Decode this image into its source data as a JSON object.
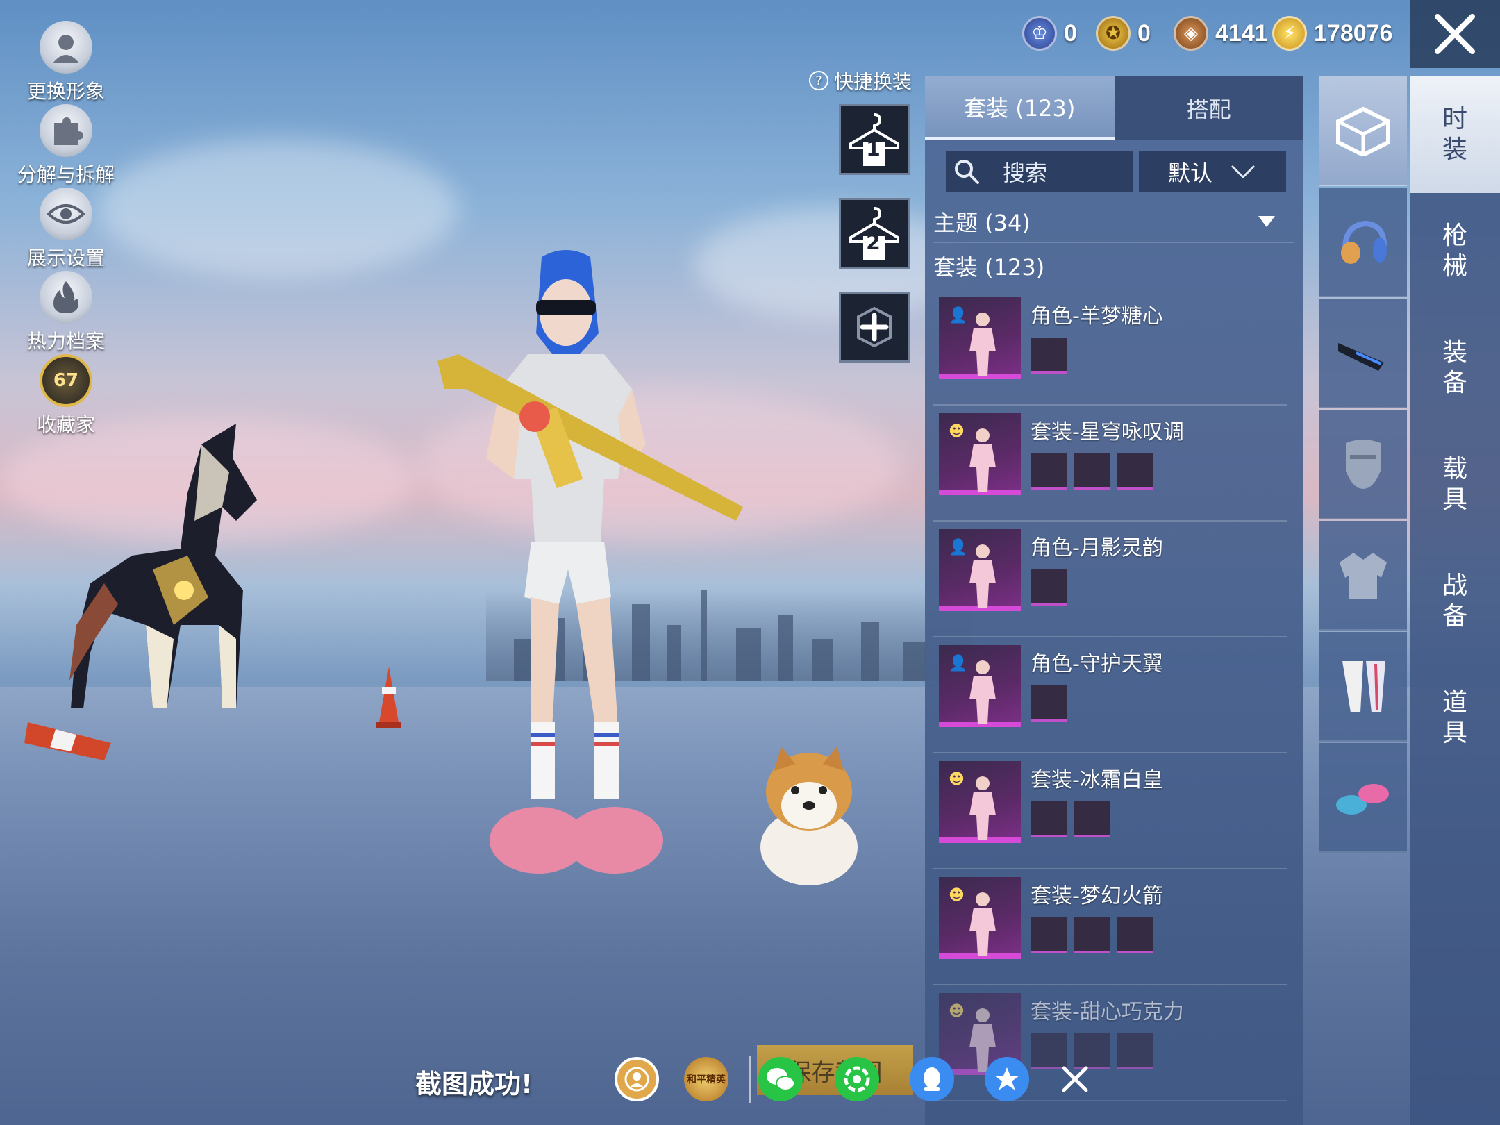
{
  "left_menu": [
    {
      "label": "更换形象",
      "icon": "avatar-icon"
    },
    {
      "label": "分解与拆解",
      "icon": "puzzle-icon"
    },
    {
      "label": "展示设置",
      "icon": "eye-icon"
    },
    {
      "label": "热力档案",
      "icon": "flame-icon"
    },
    {
      "label": "收藏家",
      "icon": "collector-badge-icon",
      "level": "67"
    }
  ],
  "currency": [
    {
      "icon": "token-blue-icon",
      "value": "0",
      "color": "#3a5fae"
    },
    {
      "icon": "token-gold-icon",
      "value": "0",
      "color": "#c89420"
    },
    {
      "icon": "coin-bronze-icon",
      "value": "4141",
      "color": "#a86a2c"
    },
    {
      "icon": "lightning-coin-icon",
      "value": "178076",
      "color": "#e8b820"
    }
  ],
  "quick_change": {
    "title": "快捷换装",
    "slots": [
      "1",
      "2"
    ]
  },
  "tabs": [
    {
      "label": "套装 (123)",
      "active": true
    },
    {
      "label": "搭配",
      "active": false
    }
  ],
  "search": {
    "placeholder": "搜索",
    "sort": "默认"
  },
  "sections": {
    "theme": "主题 (34)",
    "suits": "套装 (123)"
  },
  "items": [
    {
      "name": "角色-羊梦糖心",
      "badge": "role",
      "subs": 1
    },
    {
      "name": "套装-星穹咏叹调",
      "badge": "suit",
      "subs": 3
    },
    {
      "name": "角色-月影灵韵",
      "badge": "role",
      "subs": 1
    },
    {
      "name": "角色-守护天翼",
      "badge": "role",
      "subs": 1
    },
    {
      "name": "套装-冰霜白皇",
      "badge": "suit",
      "subs": 2
    },
    {
      "name": "套装-梦幻火箭",
      "badge": "suit",
      "subs": 3
    },
    {
      "name": "套装-甜心巧克力",
      "badge": "suit",
      "subs": 3
    }
  ],
  "categories": [
    "outfit-box-icon",
    "headphones-icon",
    "visor-icon",
    "mask-icon",
    "jacket-icon",
    "pants-icon",
    "shoes-icon"
  ],
  "right_tabs": [
    {
      "label": "时装",
      "active": true
    },
    {
      "label": "枪械",
      "active": false
    },
    {
      "label": "装备",
      "active": false
    },
    {
      "label": "载具",
      "active": false
    },
    {
      "label": "战备",
      "active": false
    },
    {
      "label": "道具",
      "active": false
    }
  ],
  "bottom": {
    "toast": "截图成功!",
    "save_label": "保存截图",
    "share_icons": [
      "profile-share-icon",
      "peace-elite-share-icon",
      "wechat-icon",
      "moments-icon",
      "qq-icon",
      "qzone-icon",
      "close-share-icon"
    ],
    "peace_elite_label": "和平精英"
  }
}
